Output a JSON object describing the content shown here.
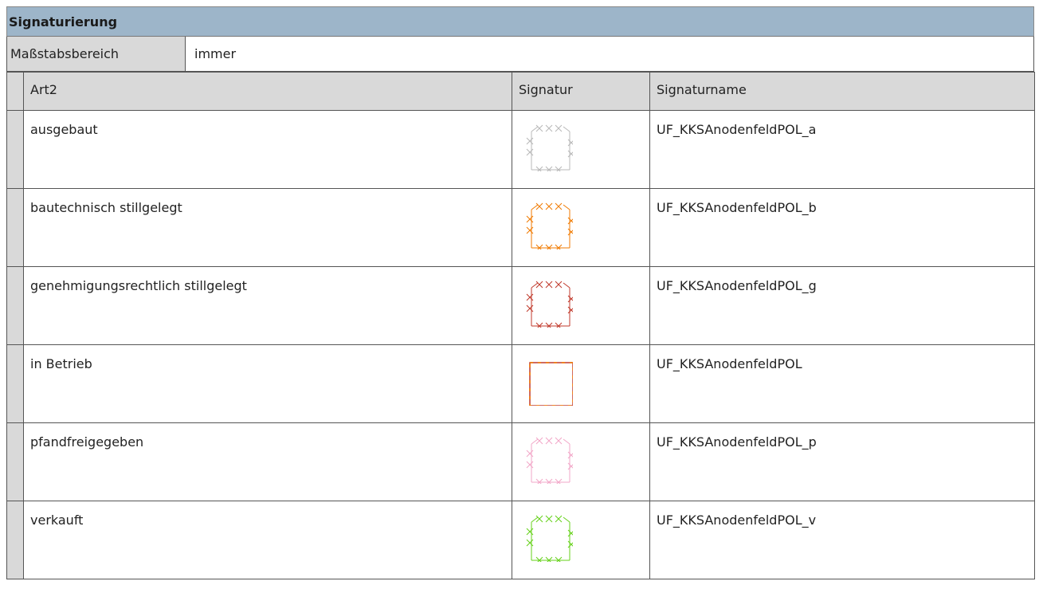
{
  "title": "Signaturierung",
  "scale": {
    "label": "Maßstabsbereich",
    "value": "immer"
  },
  "columns": {
    "art": "Art2",
    "signatur": "Signatur",
    "name": "Signaturname"
  },
  "rows": [
    {
      "art": "ausgebaut",
      "name": "UF_KKSAnodenfeldPOL_a",
      "color": "#b8b8b8",
      "style": "cross"
    },
    {
      "art": "bautechnisch stillgelegt",
      "name": "UF_KKSAnodenfeldPOL_b",
      "color": "#f07a00",
      "style": "cross"
    },
    {
      "art": "genehmigungsrechtlich stillgelegt",
      "name": "UF_KKSAnodenfeldPOL_g",
      "color": "#c0392b",
      "style": "cross"
    },
    {
      "art": "in Betrieb",
      "name": "UF_KKSAnodenfeldPOL",
      "color": "#c0392b",
      "color2": "#f07a00",
      "style": "dashed"
    },
    {
      "art": "pfandfreigegeben",
      "name": "UF_KKSAnodenfeldPOL_p",
      "color": "#f2a7c8",
      "style": "cross"
    },
    {
      "art": "verkauft",
      "name": "UF_KKSAnodenfeldPOL_v",
      "color": "#66d11a",
      "style": "cross"
    }
  ]
}
